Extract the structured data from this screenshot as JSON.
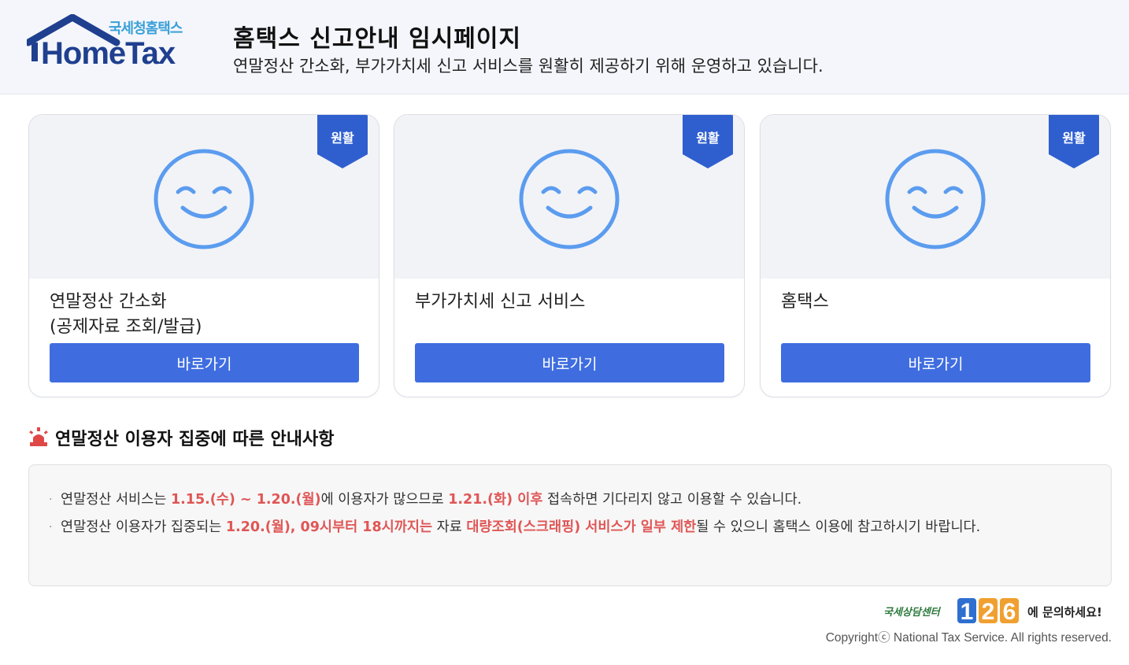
{
  "header": {
    "logo_sub": "국세청홈택스",
    "logo_main": "HomeTax",
    "title": "홈택스 신고안내 임시페이지",
    "subtitle": "연말정산 간소화, 부가가치세 신고 서비스를 원활히 제공하기 위해 운영하고 있습니다."
  },
  "colors": {
    "primary": "#3f6de0",
    "ribbon": "#2f5fcf",
    "smile": "#5b9cef",
    "highlight": "#e05656"
  },
  "cards": [
    {
      "status": "원활",
      "title": "연말정산 간소화\n(공제자료 조회/발급)",
      "button": "바로가기",
      "icon": "smile-icon"
    },
    {
      "status": "원활",
      "title": "부가가치세 신고 서비스",
      "button": "바로가기",
      "icon": "smile-icon"
    },
    {
      "status": "원활",
      "title": "홈택스",
      "button": "바로가기",
      "icon": "smile-icon"
    }
  ],
  "notice": {
    "icon": "siren-icon",
    "title": "연말정산 이용자 집중에 따른 안내사항",
    "item1": {
      "t1": "연말정산 서비스는 ",
      "h1": "1.15.(수) ~ 1.20.(월)",
      "t2": "에 이용자가 많으므로 ",
      "h2": "1.21.(화) 이후",
      "t3": " 접속하면 기다리지 않고 이용할 수 있습니다."
    },
    "item2": {
      "t1": "연말정산 이용자가 집중되는 ",
      "h1": "1.20.(월), 09시부터 18시까지는",
      "t2": " 자료 ",
      "h2": "대량조회(스크래핑) 서비스가 일부 제한",
      "t3": "될 수 있으니 홈택스 이용에 참고하시기 바랍니다."
    }
  },
  "footer": {
    "center_label": "국세상담센터",
    "number": "126",
    "ask": "에 문의하세요!",
    "copyright": "Copyrightⓒ National Tax Service. All rights reserved."
  }
}
